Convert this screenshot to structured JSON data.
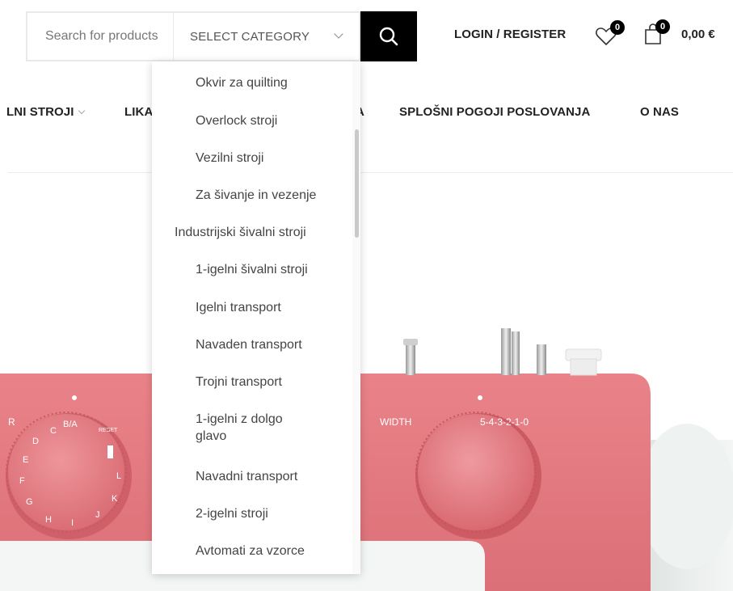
{
  "header": {
    "search_placeholder": "Search for products",
    "category_label": "SELECT CATEGORY",
    "login_label": "LOGIN / REGISTER",
    "wishlist_count": "0",
    "cart_count": "0",
    "cart_total": "0,00 €"
  },
  "nav": {
    "items": [
      {
        "label": "LNI STROJI"
      },
      {
        "label": "LIKA"
      },
      {
        "label": "A"
      },
      {
        "label": "SPLOŠNI POGOJI POSLOVANJA"
      },
      {
        "label": "O NAS"
      }
    ]
  },
  "dropdown": {
    "items": [
      {
        "label": "Okvir za quilting"
      },
      {
        "label": "Overlock stroji"
      },
      {
        "label": "Vezilni stroji"
      },
      {
        "label": "Za šivanje in vezenje"
      },
      {
        "label": "Industrijski šivalni stroji"
      },
      {
        "label": "1-igelni šivalni stroji"
      },
      {
        "label": "Igelni transport"
      },
      {
        "label": "Navaden transport"
      },
      {
        "label": "Trojni transport"
      },
      {
        "label": "1-igelni z dolgo glavo"
      },
      {
        "label": "Navadni transport"
      },
      {
        "label": "2-igelni stroji"
      },
      {
        "label": "Avtomati za vzorce"
      }
    ]
  },
  "hero": {
    "dial_left_letters": [
      "R",
      "C",
      "B/A",
      "D",
      "E",
      "F",
      "G",
      "H",
      "I",
      "J",
      "K",
      "L",
      "RESET"
    ],
    "width_label": "WIDTH",
    "width_scale": "5-4-3-2-1-0"
  },
  "colors": {
    "machine_pink": "#e5787f",
    "dial_pink": "#e57c83",
    "button_black": "#000000"
  }
}
